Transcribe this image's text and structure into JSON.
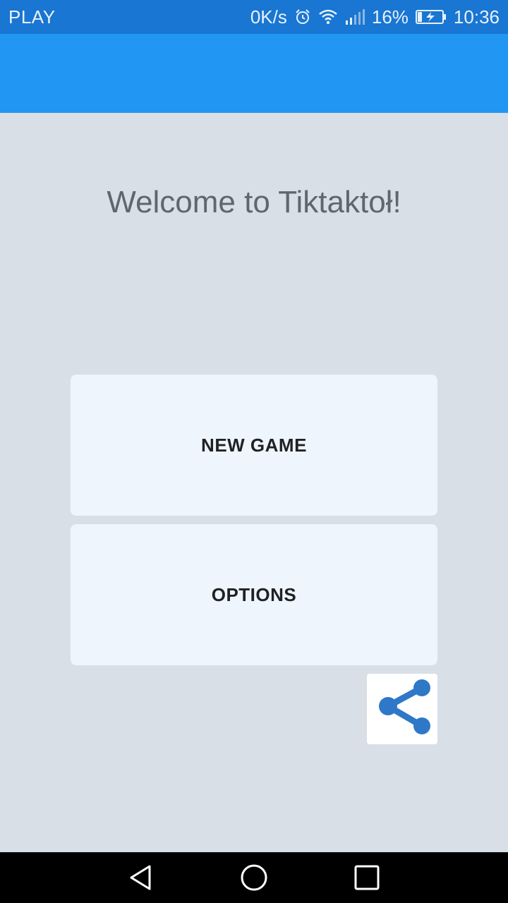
{
  "status_bar": {
    "carrier": "PLAY",
    "net_speed": "0K/s",
    "battery": "16%",
    "time": "10:36",
    "icons": [
      "alarm-icon",
      "wifi-icon",
      "signal-icon",
      "battery-charging-icon"
    ]
  },
  "main": {
    "welcome_text": "Welcome to Tiktaktoł!",
    "new_game_label": "NEW GAME",
    "options_label": "OPTIONS",
    "share_icon": "share-icon"
  },
  "nav": {
    "icons": [
      "back-icon",
      "home-icon",
      "recents-icon"
    ]
  },
  "colors": {
    "status_bar": "#1976d2",
    "app_bar": "#2196f3",
    "background": "#d8dfe6",
    "button_bg": "#eef5fd",
    "share_accent": "#2f78c8"
  }
}
